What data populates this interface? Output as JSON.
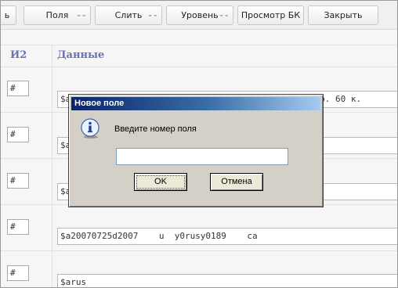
{
  "toolbar": {
    "buttons": [
      {
        "label": "ь",
        "has_menu": false
      },
      {
        "label": "Поля",
        "has_menu": true
      },
      {
        "label": "Слить",
        "has_menu": true
      },
      {
        "label": "Уровень",
        "has_menu": true
      },
      {
        "label": "Просмотр БК",
        "has_menu": false
      },
      {
        "label": "Закрыть",
        "has_menu": false
      }
    ],
    "menu_glyph": "⌄⌄"
  },
  "table": {
    "headers": {
      "col1": "И2",
      "col2": "Данные"
    },
    "rows": [
      {
        "num": "#",
        "data": "$a                                            292 р. 60 к."
      },
      {
        "num": "#",
        "data": "$a"
      },
      {
        "num": "#",
        "data": "$a"
      },
      {
        "num": "#",
        "data": "$a20070725d2007    u  y0rusy0189    ca"
      },
      {
        "num": "#",
        "data": "$arus"
      }
    ]
  },
  "dialog": {
    "title": "Новое поле",
    "prompt": "Введите номер поля",
    "input_value": "",
    "ok_label": "OK",
    "cancel_label": "Отмена"
  },
  "colors": {
    "header_text": "#6b72b4",
    "title_bar_start": "#0a246a",
    "title_bar_end": "#a6caf0",
    "dialog_bg": "#d4d0c8"
  }
}
